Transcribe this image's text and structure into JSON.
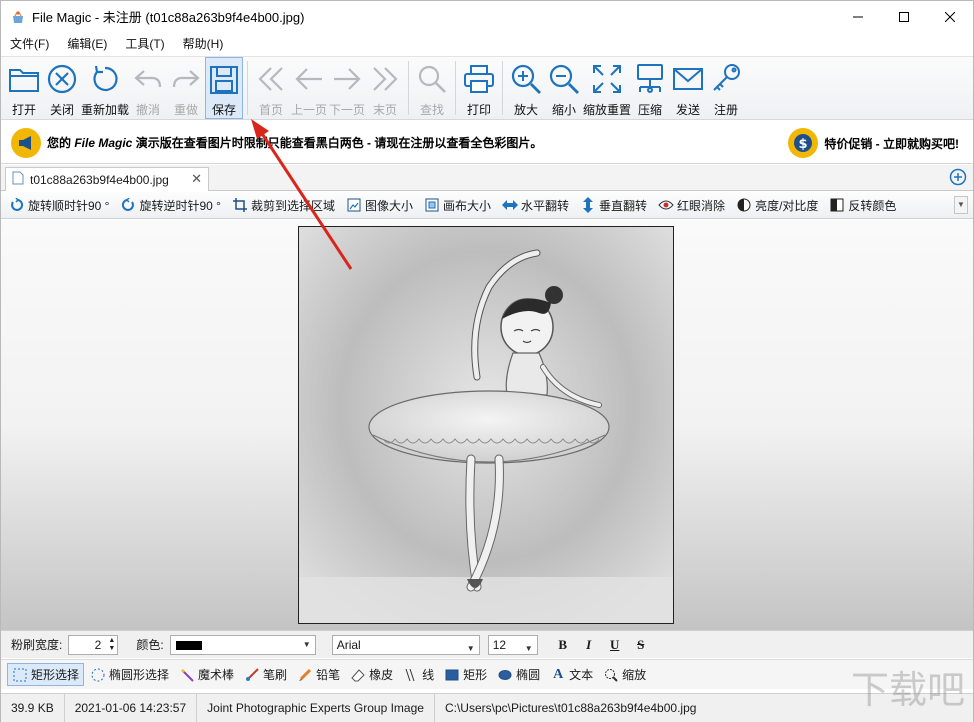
{
  "window": {
    "title": "File Magic - 未注册 (t01c88a263b9f4e4b00.jpg)",
    "controls": [
      "minimize",
      "maximize",
      "close"
    ]
  },
  "menu": [
    "文件(F)",
    "编辑(E)",
    "工具(T)",
    "帮助(H)"
  ],
  "toolbar": {
    "open": "打开",
    "close": "关闭",
    "reload": "重新加载",
    "undo": "撤消",
    "redo": "重做",
    "save": "保存",
    "first": "首页",
    "prev": "上一页",
    "next": "下一页",
    "last": "末页",
    "find": "查找",
    "print": "打印",
    "zoom_in": "放大",
    "zoom_out": "缩小",
    "zoom_reset": "缩放重置",
    "compress": "压缩",
    "send": "发送",
    "register": "注册"
  },
  "promo": {
    "left_prefix": "您的 ",
    "left_app": "File Magic",
    "left_rest": " 演示版在查看图片时限制只能查看黑白两色 - 请现在注册以查看全色彩图片。",
    "right": "特价促销 - 立即就购买吧!"
  },
  "tab": {
    "filename": "t01c88a263b9f4e4b00.jpg",
    "close": "✕"
  },
  "edit_tools": [
    "旋转顺时针90 °",
    "旋转逆时针90 °",
    "裁剪到选择区域",
    "图像大小",
    "画布大小",
    "水平翻转",
    "垂直翻转",
    "红眼消除",
    "亮度/对比度",
    "反转颜色"
  ],
  "brush": {
    "width_label": "粉刷宽度:",
    "width_value": "2",
    "color_label": "颜色:",
    "color_value": "#000000",
    "font": "Arial",
    "font_size": "12",
    "format": [
      "B",
      "I",
      "U",
      "S"
    ]
  },
  "draw_tools": [
    "矩形选择",
    "椭圆形选择",
    "魔术棒",
    "笔刷",
    "铅笔",
    "橡皮",
    "线",
    "矩形",
    "椭圆",
    "文本",
    "缩放"
  ],
  "status": {
    "size": "39.9 KB",
    "datetime": "2021-01-06 14:23:57",
    "type": "Joint Photographic Experts Group Image",
    "path": "C:\\Users\\pc\\Pictures\\t01c88a263b9f4e4b00.jpg"
  },
  "watermark": "下载吧"
}
